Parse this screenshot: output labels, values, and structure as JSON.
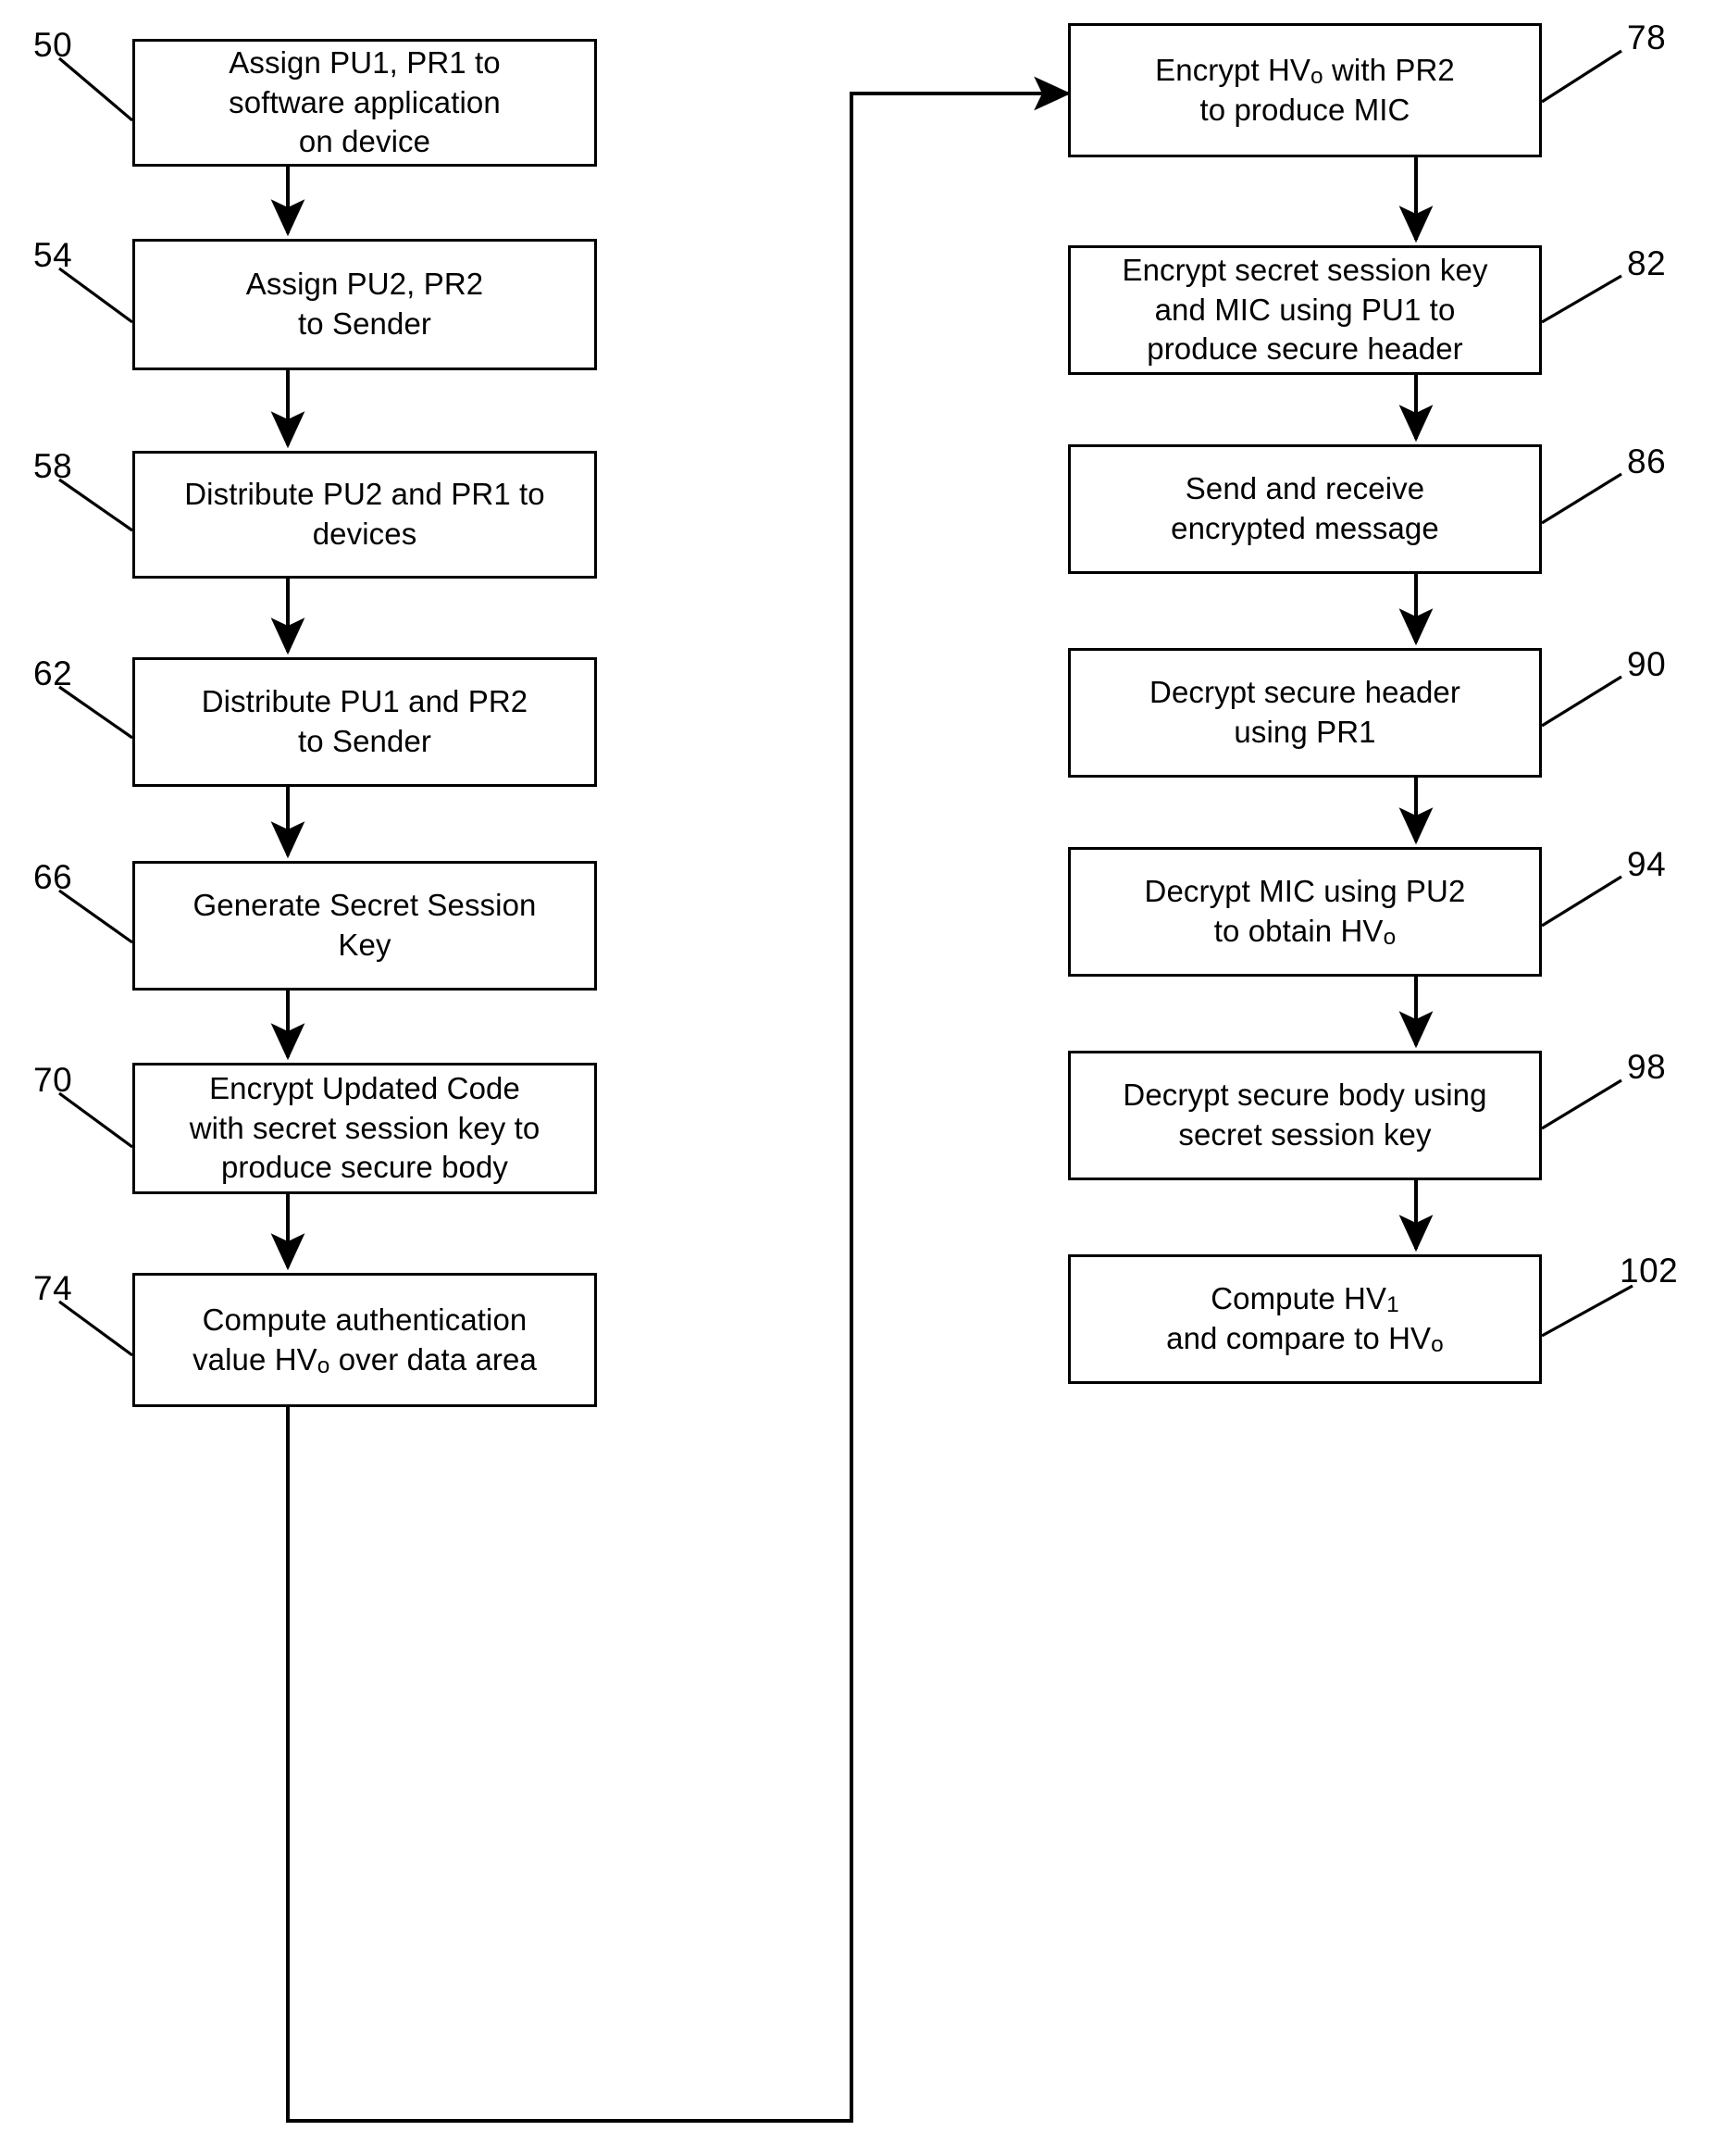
{
  "figure": {
    "type": "patent-flowchart",
    "title": "",
    "left_column": [
      {
        "ref": "50",
        "text": "Assign PU1, PR1 to\nsoftware application\non device"
      },
      {
        "ref": "54",
        "text": "Assign PU2, PR2\nto Sender"
      },
      {
        "ref": "58",
        "text": "Distribute PU2 and PR1 to\ndevices"
      },
      {
        "ref": "62",
        "text": "Distribute PU1 and PR2\nto Sender"
      },
      {
        "ref": "66",
        "text": "Generate Secret Session\nKey"
      },
      {
        "ref": "70",
        "text": "Encrypt Updated Code\nwith secret session key to\nproduce secure body"
      },
      {
        "ref": "74",
        "text": "Compute authentication\nvalue HVo over data area"
      }
    ],
    "right_column": [
      {
        "ref": "78",
        "text": "Encrypt HVo with PR2\nto produce MIC"
      },
      {
        "ref": "82",
        "text": "Encrypt secret session key\nand MIC using PU1 to\nproduce secure header"
      },
      {
        "ref": "86",
        "text": "Send and receive\nencrypted message"
      },
      {
        "ref": "90",
        "text": "Decrypt secure header\nusing PR1"
      },
      {
        "ref": "94",
        "text": "Decrypt MIC using PU2\nto obtain HVo"
      },
      {
        "ref": "98",
        "text": "Decrypt secure body using\nsecret session key"
      },
      {
        "ref": "102",
        "text": "Compute HV1\nand compare to HVo"
      }
    ],
    "colors": {
      "stroke": "#000000",
      "fill": "#ffffff",
      "text": "#000000"
    }
  }
}
